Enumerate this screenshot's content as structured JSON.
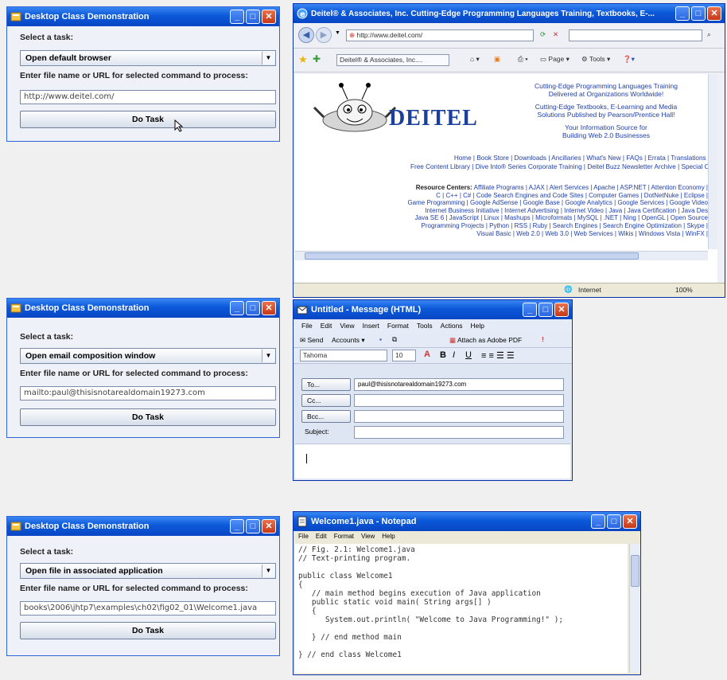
{
  "demo": {
    "title": "Desktop Class Demonstration",
    "select_label": "Select a task:",
    "enter_label": "Enter file name or URL for selected command to process:",
    "button": "Do Task",
    "panels": [
      {
        "task": "Open default browser",
        "input": "http://www.deitel.com/"
      },
      {
        "task": "Open email composition window",
        "input": "mailto:paul@thisisnotarealdomain19273.com"
      },
      {
        "task": "Open file in associated application",
        "input": "books\\2006\\jhtp7\\examples\\ch02\\fig02_01\\Welcome1.java"
      }
    ]
  },
  "browser": {
    "title": "Deitel® & Associates, Inc. Cutting-Edge Programming Languages Training, Textbooks, E-...",
    "address": "http://www.deitel.com/",
    "tab": "Deitel® & Associates, Inc....",
    "toolbar": {
      "page": "Page",
      "tools": "Tools"
    },
    "logo": "DEITEL",
    "tagline": [
      "Cutting-Edge Programming Languages Training",
      "Delivered at Organizations Worldwide!",
      "Cutting-Edge Textbooks, E-Learning and Media",
      "Solutions Published by Pearson/Prentice Hall!",
      "Your Information Source for",
      "Building Web 2.0 Businesses"
    ],
    "nav": [
      "Home | Book Store | Downloads | Ancillaries | What's New | FAQs | Errata | Translations |",
      "Free Content Library | Dive Into® Series Corporate Training | Deitel Buzz Newsletter Archive | Special O"
    ],
    "resource_heading": "Resource Centers:",
    "resources": [
      "Affiliate Programs | AJAX | Alert Services | Apache | ASP.NET | Attention Economy |",
      "C | C++ | C# | Code Search Engines and Code Sites | Computer Games | DotNetNuke | Eclipse |",
      "Game Programming | Google AdSense | Google Base | Google Analytics | Google Services | Google Video",
      "Internet Business Initiative | Internet Advertising | Internet Video | Java | Java Certification | Java Des",
      "Java SE 6 | JavaScript | Linux | Mashups | Microformats | MySQL | .NET | Ning | OpenGL | Open Source",
      "Programming Projects | Python | RSS | Ruby | Search Engines | Search Engine Optimization | Skype |",
      "Visual Basic | Web 2.0 | Web 3.0 | Web Services | Wikis | Windows Vista | WinFX |"
    ],
    "status_zone": "Internet",
    "zoom": "100%"
  },
  "outlook": {
    "title": "Untitled - Message (HTML)",
    "menu": [
      "File",
      "Edit",
      "View",
      "Insert",
      "Format",
      "Tools",
      "Actions",
      "Help"
    ],
    "send": "Send",
    "accounts": "Accounts",
    "attach_pdf": "Attach as Adobe PDF",
    "font": "Tahoma",
    "size": "10",
    "to_label": "To...",
    "cc_label": "Cc...",
    "bcc_label": "Bcc...",
    "subject_label": "Subject:",
    "to_value": "paul@thisisnotarealdomain19273.com"
  },
  "notepad": {
    "title": "Welcome1.java - Notepad",
    "menu": [
      "File",
      "Edit",
      "Format",
      "View",
      "Help"
    ],
    "code": "// Fig. 2.1: Welcome1.java\n// Text-printing program.\n\npublic class Welcome1\n{\n   // main method begins execution of Java application\n   public static void main( String args[] )\n   {\n      System.out.println( \"Welcome to Java Programming!\" );\n\n   } // end method main\n\n} // end class Welcome1"
  }
}
